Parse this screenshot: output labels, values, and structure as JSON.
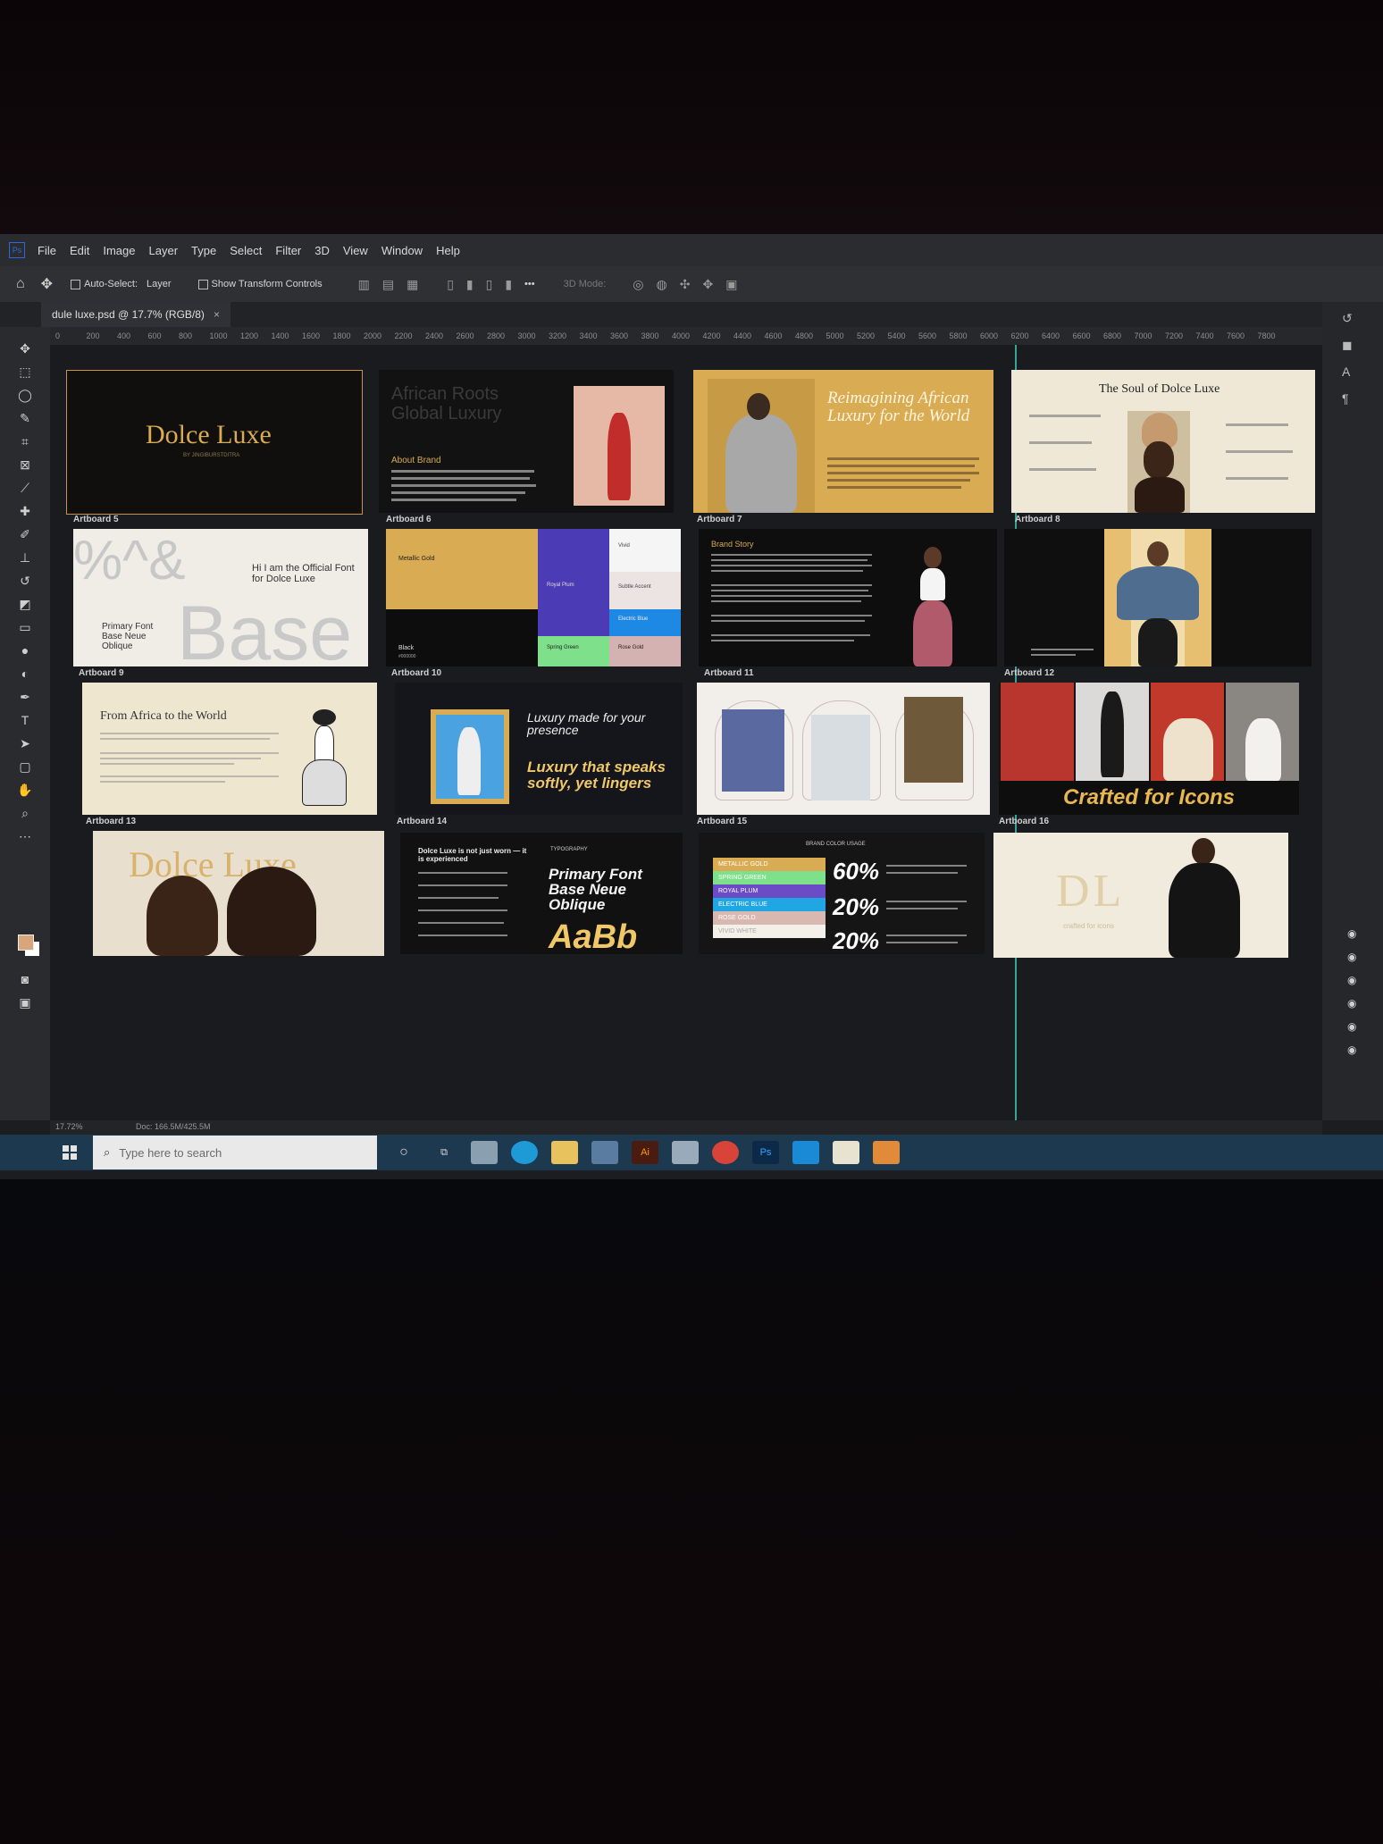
{
  "app": {
    "logo": "Ps",
    "menu": [
      "File",
      "Edit",
      "Image",
      "Layer",
      "Type",
      "Select",
      "Filter",
      "3D",
      "View",
      "Window",
      "Help"
    ]
  },
  "options_bar": {
    "home_icon": "home-icon",
    "move_icon": "move-tool-icon",
    "auto_select": "Auto-Select:",
    "layer_select": "Layer",
    "show_transform": "Show Transform Controls",
    "more": "•••",
    "mode_3d": "3D Mode:"
  },
  "document_tab": {
    "title": "dule luxe.psd @ 17.7% (RGB/8)",
    "close": "×"
  },
  "ruler_ticks": [
    "0",
    "200",
    "400",
    "600",
    "800",
    "1000",
    "1200",
    "1400",
    "1600",
    "1800",
    "2000",
    "2200",
    "2400",
    "2600",
    "2800",
    "3000",
    "3200",
    "3400",
    "3600",
    "3800",
    "4000",
    "4200",
    "4400",
    "4600",
    "4800",
    "5000",
    "5200",
    "5400",
    "5600",
    "5800",
    "6000",
    "6200",
    "6400",
    "6600",
    "6800",
    "7000",
    "7200",
    "7400",
    "7600",
    "7800"
  ],
  "artboards": {
    "a5": {
      "label": "Artboard 5",
      "title": "Dolce Luxe",
      "sub": "BY JINGIBURSTDITRA"
    },
    "a6": {
      "label": "Artboard 6",
      "heading": "African Roots Global Luxury",
      "about": "About Brand"
    },
    "a7": {
      "label": "Artboard 7",
      "headline": "Reimagining African Luxury for the World"
    },
    "a8": {
      "label": "Artboard 8",
      "title": "The Soul of Dolce Luxe"
    },
    "a9": {
      "label": "Artboard 9",
      "glyphs": "%^&",
      "intro": "Hi I am the Official Font for Dolce Luxe",
      "font_name": "Primary Font Base Neue Oblique",
      "big": "Base"
    },
    "a10": {
      "label": "Artboard 10",
      "gold": "Metallic Gold",
      "black": "Black",
      "hex": "#000000",
      "royal": "Royal Plum",
      "subtle": "Subtle Accent",
      "electric": "Electric Blue",
      "spring": "Spring Green",
      "rose": "Rose Gold",
      "white": "Vivid"
    },
    "a11": {
      "label": "Artboard 11",
      "title": "Brand Story"
    },
    "a12": {
      "label": "Artboard 12"
    },
    "a13": {
      "label": "Artboard 13",
      "title": "From Africa to the World"
    },
    "a14": {
      "label": "Artboard 14",
      "line1": "Luxury made for your presence",
      "line2": "Luxury that speaks softly, yet lingers"
    },
    "a15": {
      "label": "Artboard 15"
    },
    "a16": {
      "label": "Artboard 16",
      "caption": "Crafted for Icons"
    },
    "b1": {
      "title": "Dolce Luxe"
    },
    "b2": {
      "headline": "Dolce Luxe is not just worn — it is experienced",
      "typo": "TYPOGRAPHY",
      "primary": "Primary Font Base Neue Oblique",
      "sample": "AaBb"
    },
    "b3": {
      "title": "BRAND COLOR USAGE",
      "rows": [
        {
          "label": "METALLIC GOLD",
          "pct": "60%"
        },
        {
          "label": "SPRING GREEN",
          "pct": ""
        },
        {
          "label": "ROYAL PLUM",
          "pct": "20%"
        },
        {
          "label": "ELECTRIC BLUE",
          "pct": ""
        },
        {
          "label": "ROSE GOLD",
          "pct": "20%"
        },
        {
          "label": "VIVID WHITE",
          "pct": ""
        }
      ]
    },
    "b4": {
      "monogram": "DL",
      "sub": "crafted for icons"
    }
  },
  "colors": {
    "gold": "#d9ab52",
    "plum": "#4b3bb5",
    "blue": "#1e88e5",
    "green": "#7ee08a",
    "rose": "#d4b2b2",
    "cream": "#efe8d6"
  },
  "status": {
    "zoom": "17.72%",
    "doc": "Doc: 166.5M/425.5M"
  },
  "taskbar": {
    "search_placeholder": "Type here to search",
    "apps": [
      "cortana-icon",
      "task-view-icon",
      "folder-icon",
      "edge-icon",
      "file-explorer-icon",
      "store-icon",
      "illustrator-icon",
      "app-icon",
      "chrome-icon",
      "photoshop-icon",
      "outlook-icon",
      "game-icon",
      "active-app-icon"
    ]
  }
}
